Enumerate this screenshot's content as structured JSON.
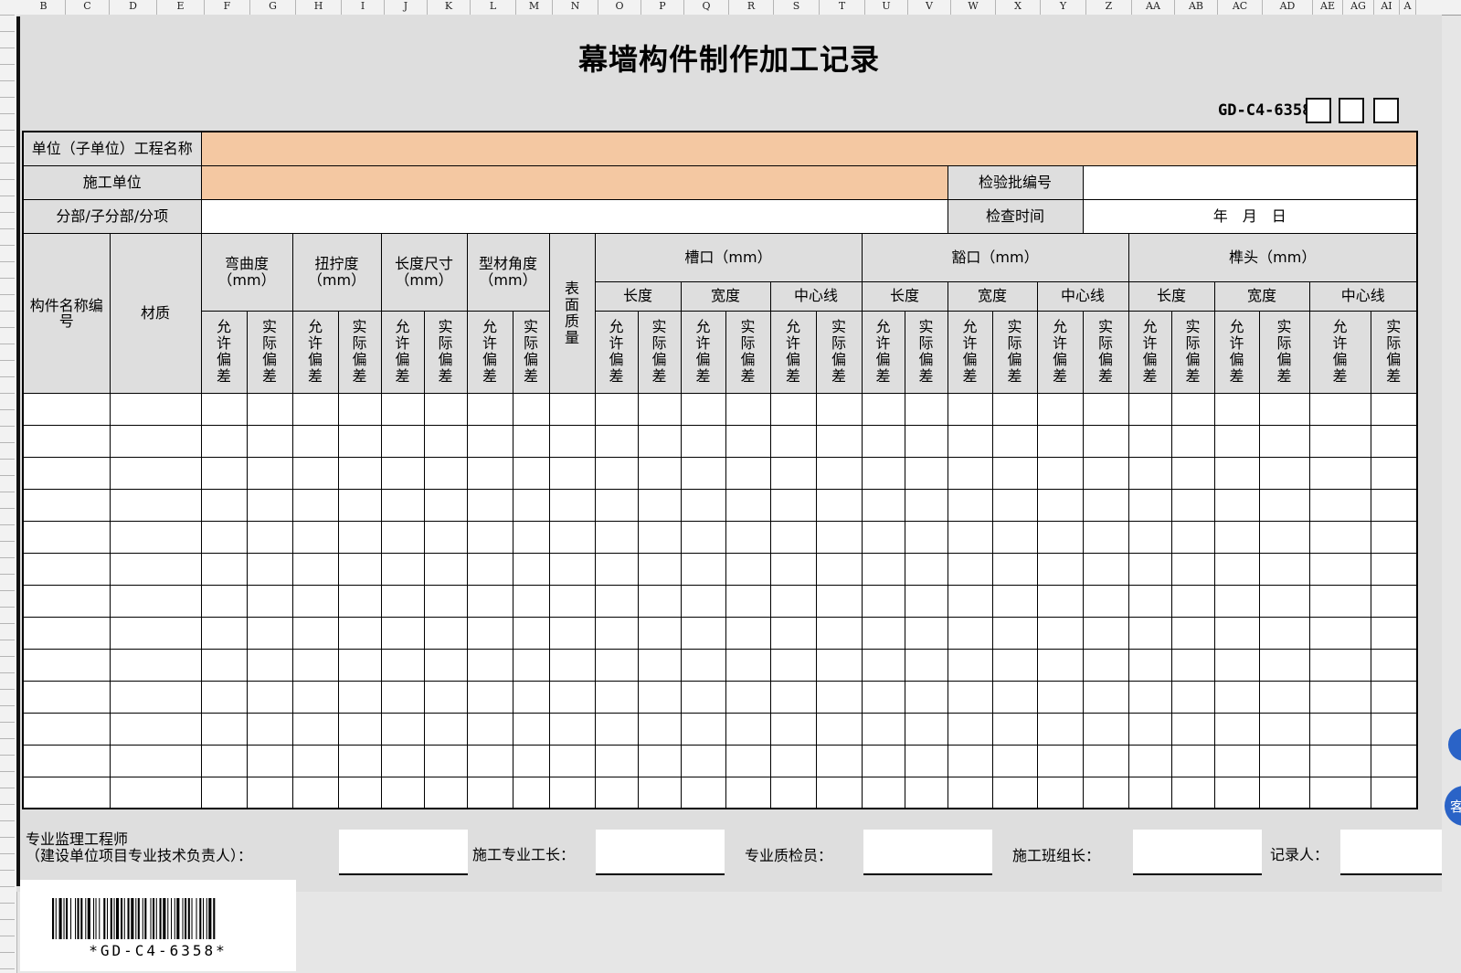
{
  "col_headers": [
    "B",
    "C",
    "D",
    "E",
    "F",
    "G",
    "H",
    "I",
    "J",
    "K",
    "L",
    "M",
    "N",
    "O",
    "P",
    "Q",
    "R",
    "S",
    "T",
    "U",
    "V",
    "W",
    "X",
    "Y",
    "Z",
    "AA",
    "AB",
    "AC",
    "AD",
    "AE",
    "AG",
    "AI",
    "A"
  ],
  "title": "幕墙构件制作加工记录",
  "code": "GD-C4-6358",
  "rows": {
    "project_label": "单位（子单位）工程名称",
    "contractor_label": "施工单位",
    "batch_label": "检验批编号",
    "division_label": "分部/子分部/分项",
    "check_time_label": "检查时间",
    "date_text": "年　月　日"
  },
  "headers": {
    "name_code": "构件名称编号",
    "material": "材质",
    "bend": "弯曲度（mm）",
    "twist": "扭拧度（mm）",
    "length_size": "长度尺寸（mm）",
    "profile_angle": "型材角度（mm）",
    "surface": "表面质量",
    "slot": "槽口（mm）",
    "notch": "豁口（mm）",
    "tenon": "榫头（mm）",
    "len": "长度",
    "width": "宽度",
    "center": "中心线",
    "allow": "允许偏差",
    "actual": "实际偏差"
  },
  "footer": {
    "supervisor_line1": "专业监理工程师",
    "supervisor_line2": "（建设单位项目专业技术负责人）：",
    "foreman": "施工专业工长：",
    "inspector": "专业质检员：",
    "team_leader": "施工班组长：",
    "recorder": "记录人："
  },
  "barcode_text": "*GD-C4-6358*",
  "side_button": "客"
}
